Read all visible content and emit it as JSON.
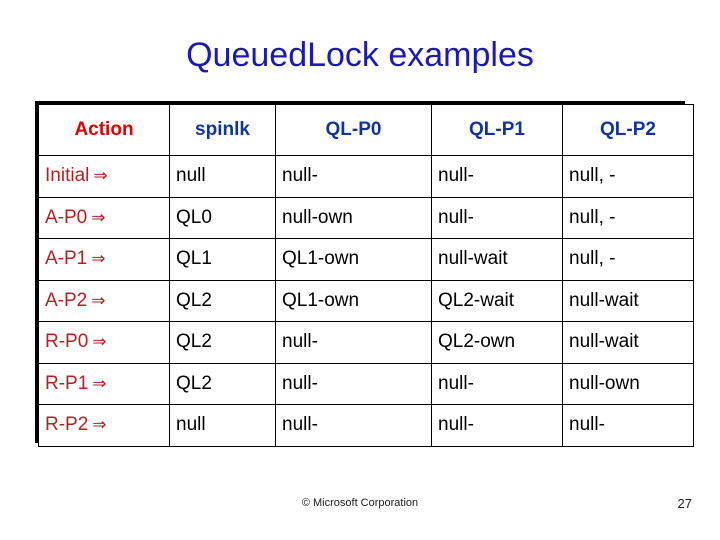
{
  "slide": {
    "title": "QueuedLock examples",
    "title_color": "#1A1AB5"
  },
  "table": {
    "header_color_action": "#E00000",
    "header_color_other": "#12349C",
    "action_column_color": "#B62020",
    "arrow_glyph": "⇒",
    "columns": [
      {
        "key": "action",
        "label": "Action"
      },
      {
        "key": "spinlk",
        "label": "spinlk"
      },
      {
        "key": "p0",
        "label": "QL-P0"
      },
      {
        "key": "p1",
        "label": "QL-P1"
      },
      {
        "key": "p2",
        "label": "QL-P2"
      }
    ],
    "rows": [
      {
        "action": "Initial",
        "spinlk": "null",
        "p0": "null-",
        "p1": "null-",
        "p2": "null, -"
      },
      {
        "action": "A-P0",
        "spinlk": "QL0",
        "p0": "null-own",
        "p1": "null-",
        "p2": "null, -"
      },
      {
        "action": "A-P1",
        "spinlk": "QL1",
        "p0": "QL1-own",
        "p1": "null-wait",
        "p2": "null, -"
      },
      {
        "action": "A-P2",
        "spinlk": "QL2",
        "p0": "QL1-own",
        "p1": "QL2-wait",
        "p2": "null-wait"
      },
      {
        "action": "R-P0",
        "spinlk": "QL2",
        "p0": "null-",
        "p1": "QL2-own",
        "p2": "null-wait"
      },
      {
        "action": "R-P1",
        "spinlk": "QL2",
        "p0": "null-",
        "p1": "null-",
        "p2": "null-own"
      },
      {
        "action": "R-P2",
        "spinlk": "null",
        "p0": "null-",
        "p1": "null-",
        "p2": "null-"
      }
    ]
  },
  "footer": {
    "copyright": "© Microsoft Corporation",
    "page_number": "27"
  }
}
